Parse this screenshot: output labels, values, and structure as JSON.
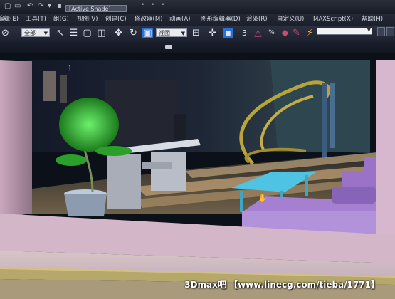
{
  "title_field": "[Active Shade]",
  "menu": {
    "items": [
      {
        "label": "编辑(E)"
      },
      {
        "label": "工具(T)"
      },
      {
        "label": "组(G)"
      },
      {
        "label": "视图(V)"
      },
      {
        "label": "创建(C)"
      },
      {
        "label": "修改器(M)"
      },
      {
        "label": "动画(A)"
      },
      {
        "label": "图形编辑器(D)"
      },
      {
        "label": "渲染(R)"
      },
      {
        "label": "自定义(U)"
      },
      {
        "label": "MAXScript(X)"
      },
      {
        "label": "帮助(H)"
      }
    ]
  },
  "toolbar": {
    "selection_filter": "全部",
    "ref_coord": "视图",
    "angle_snap_label": "3"
  },
  "viewport": {
    "label": "]"
  },
  "watermark": "3Dmax吧 【www.linecg.com/tieba/1771】",
  "colors": {
    "accent": "#2b6fd8",
    "pink_wall": "#d8b8cc",
    "purple_sofa": "#a57fd0",
    "cyan_table": "#43b5d8",
    "green_plant": "#3cc83c",
    "brass_rail": "#b8a43a"
  }
}
